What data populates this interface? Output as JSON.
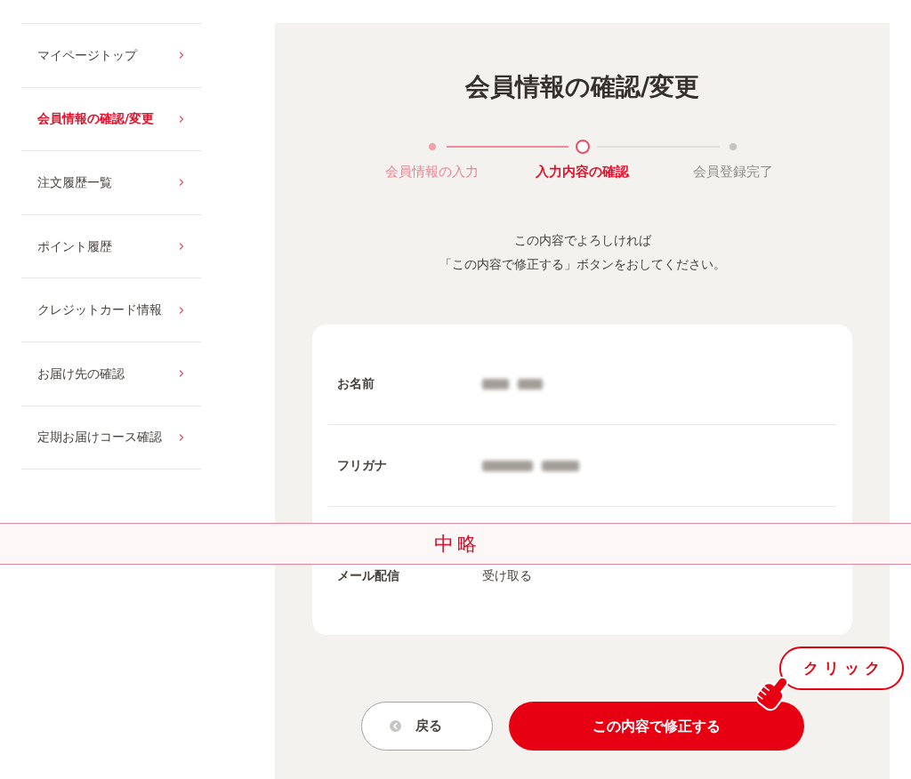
{
  "sidebar": {
    "items": [
      {
        "label": "マイページトップ",
        "selected": false
      },
      {
        "label": "会員情報の確認/変更",
        "selected": true
      },
      {
        "label": "注文履歴一覧",
        "selected": false
      },
      {
        "label": "ポイント履歴",
        "selected": false
      },
      {
        "label": "クレジットカード情報",
        "selected": false
      },
      {
        "label": "お届け先の確認",
        "selected": false
      },
      {
        "label": "定期お届けコース確認",
        "selected": false
      }
    ]
  },
  "page_title": "会員情報の確認/変更",
  "steps": [
    {
      "label": "会員情報の入力",
      "reached": true,
      "selected": false
    },
    {
      "label": "入力内容の確認",
      "reached": true,
      "selected": true
    },
    {
      "label": "会員登録完了",
      "reached": false,
      "selected": false
    }
  ],
  "instructions": [
    "この内容でよろしければ",
    "「この内容で修正する」ボタンをおしてください。"
  ],
  "fields": [
    {
      "label": "お名前",
      "redacted": true
    },
    {
      "label": "フリガナ",
      "redacted": true
    },
    {
      "label": "メール配信",
      "value": "受け取る",
      "redacted": false
    }
  ],
  "omission_banner": {
    "text": "中略"
  },
  "buttons": [
    {
      "label": "戻る",
      "kind": "back"
    },
    {
      "label": "この内容で修正する",
      "kind": "primary"
    }
  ],
  "callout": {
    "text": "クリック"
  }
}
